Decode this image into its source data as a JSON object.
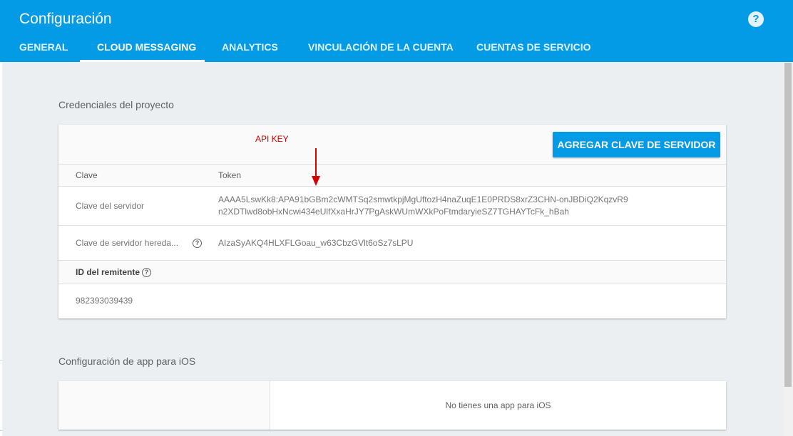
{
  "header": {
    "title": "Configuración",
    "help_icon": "help-circle-icon",
    "tabs": [
      {
        "label": "GENERAL",
        "active": false
      },
      {
        "label": "CLOUD MESSAGING",
        "active": true
      },
      {
        "label": "ANALYTICS",
        "active": false
      },
      {
        "label": "VINCULACIÓN DE LA CUENTA",
        "active": false
      },
      {
        "label": "CUENTAS DE SERVICIO",
        "active": false
      }
    ]
  },
  "credentials": {
    "section_title": "Credenciales del proyecto",
    "annotation": "API KEY",
    "add_key_button": "AGREGAR CLAVE DE SERVIDOR",
    "columns": {
      "key": "Clave",
      "token": "Token"
    },
    "rows": [
      {
        "label": "Clave del servidor",
        "token_line1": "AAAA5LswKk8:APA91bGBm2cWMTSq2smwtkpjMgUftozH4naZuqE1E0PRDS8xrZ3CHN-onJBDiQ2KqzvR9",
        "token_line2": "n2XDTlwd8obHxNcwi434eUlfXxaHrJY7PgAskWUmWXkPoFtmdaryieSZ7TGHAYTcFk_hBah"
      },
      {
        "label": "Clave de servidor hereda...",
        "token": "AIzaSyAKQ4HLXFLGoau_w63CbzGVlt6oSz7sLPU"
      }
    ],
    "sender_id_label": "ID del remitente",
    "sender_id": "982393039439"
  },
  "ios": {
    "section_title": "Configuración de app para iOS",
    "empty_message": "No tienes una app para iOS"
  },
  "colors": {
    "header_bg": "#039be5",
    "annotation": "#d50000",
    "page_bg": "#eceff1"
  }
}
